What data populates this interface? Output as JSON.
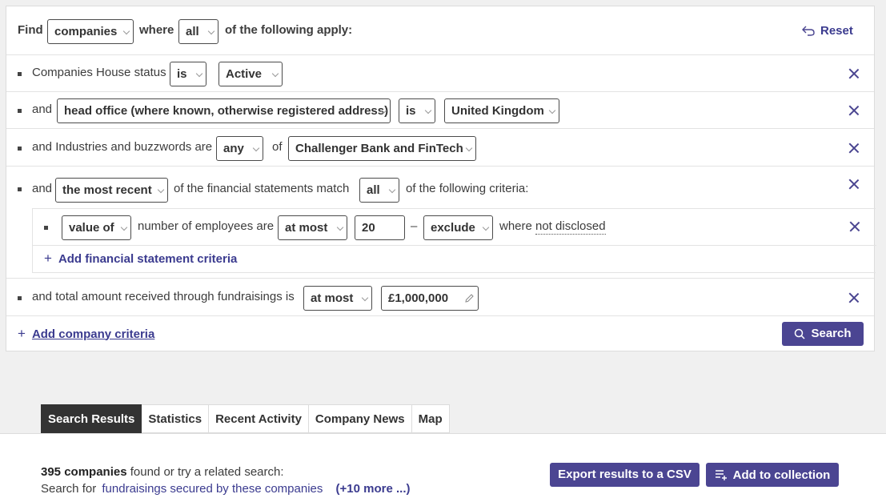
{
  "header": {
    "find_label": "Find",
    "entity": "companies",
    "where_label": "where",
    "match_mode": "all",
    "apply_label": "of the following apply:",
    "reset_label": "Reset"
  },
  "criteria": {
    "status": {
      "label": "Companies House status",
      "op": "is",
      "value": "Active"
    },
    "office": {
      "and": "and",
      "field": "head office (where known, otherwise registered address)",
      "op": "is",
      "value": "United Kingdom"
    },
    "industry": {
      "label": "and Industries and buzzwords are",
      "mode": "any",
      "of": "of",
      "value": "Challenger Bank and FinTech"
    },
    "financial": {
      "and": "and",
      "which": "the most recent",
      "mid": "of the financial statements match",
      "mode": "all",
      "tail": "of the following criteria:",
      "sub": {
        "metric": "value of",
        "label": "number of employees are",
        "op": "at most",
        "value": "20",
        "dash": "–",
        "exclude": "exclude",
        "where": "where",
        "nd": "not disclosed"
      },
      "add_label": "Add financial statement criteria"
    },
    "funding": {
      "label": "and total amount received through fundraisings is",
      "op": "at most",
      "value": "£1,000,000"
    }
  },
  "footer": {
    "add_label": "Add company criteria",
    "search_label": "Search"
  },
  "tabs": [
    "Search Results",
    "Statistics",
    "Recent Activity",
    "Company News",
    "Map"
  ],
  "results": {
    "count": "395 companies",
    "found_text": "found or try a related search:",
    "search_for": "Search for",
    "related_link": "fundraisings secured by these companies",
    "more_link": "(+10 more ...)",
    "export_label": "Export results to a CSV",
    "collection_label": "Add to collection"
  },
  "colors": {
    "accent": "#4b4592",
    "link": "#3b3b8f"
  }
}
